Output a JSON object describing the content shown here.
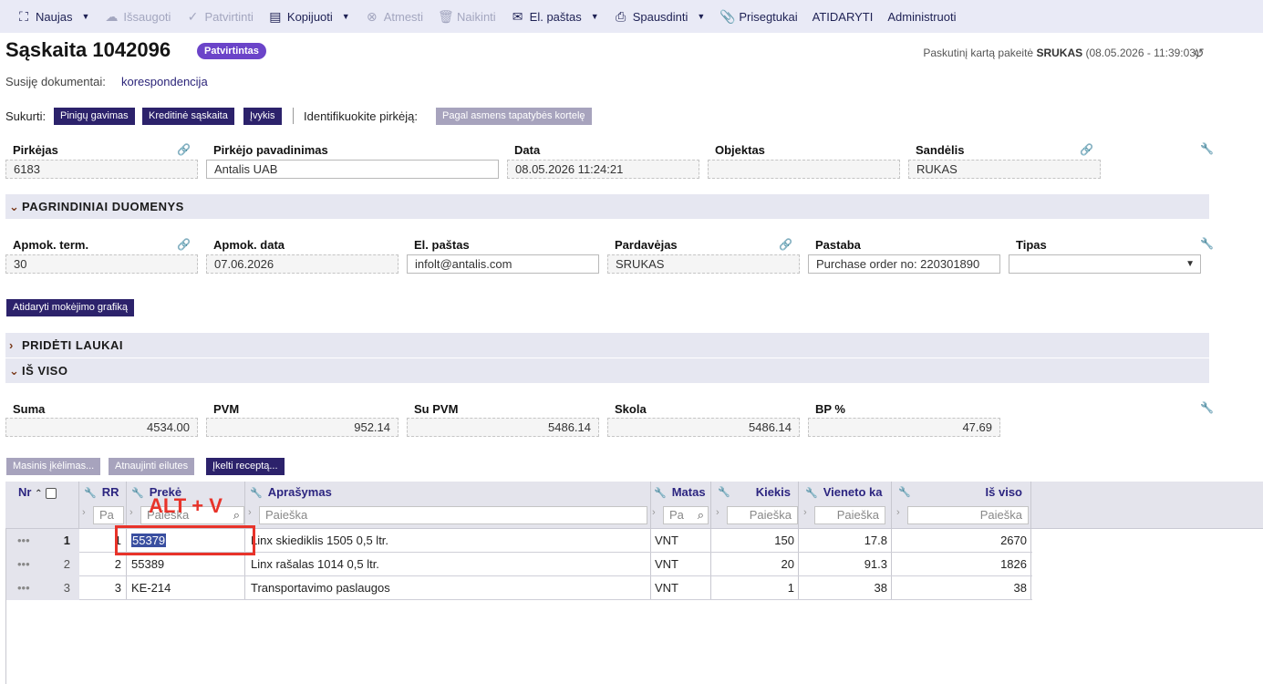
{
  "toolbar": {
    "new": "Naujas",
    "save": "Išsaugoti",
    "confirm": "Patvirtinti",
    "copy": "Kopijuoti",
    "reject": "Atmesti",
    "delete": "Naikinti",
    "email": "El. paštas",
    "print": "Spausdinti",
    "attachments": "Prisegtukai",
    "open": "ATIDARYTI",
    "administer": "Administruoti"
  },
  "header": {
    "title": "Sąskaita 1042096",
    "status_badge": "Patvirtintas",
    "last_modified_prefix": "Paskutinį kartą pakeitė",
    "last_modified_user": "SRUKAS",
    "last_modified_time": "(08.05.2026 - 11:39:03)"
  },
  "related": {
    "label": "Susiję dokumentai:",
    "link": "korespondencija"
  },
  "create": {
    "label": "Sukurti:",
    "buttons": [
      "Pinigų gavimas",
      "Kreditinė sąskaita",
      "Įvykis"
    ],
    "identify_label": "Identifikuokite pirkėją:",
    "identify_button": "Pagal asmens tapatybės kortelę"
  },
  "main_fields": {
    "buyer_label": "Pirkėjas",
    "buyer_value": "6183",
    "buyer_name_label": "Pirkėjo pavadinimas",
    "buyer_name_value": "Antalis UAB",
    "date_label": "Data",
    "date_value": "08.05.2026 11:24:21",
    "object_label": "Objektas",
    "object_value": "",
    "warehouse_label": "Sandėlis",
    "warehouse_value": "RUKAS"
  },
  "sections": {
    "main_data": "PAGRINDINIAI DUOMENYS",
    "added_fields": "PRIDĖTI LAUKAI",
    "total": "IŠ VISO"
  },
  "main_data": {
    "pay_term_label": "Apmok. term.",
    "pay_term_value": "30",
    "pay_date_label": "Apmok. data",
    "pay_date_value": "07.06.2026",
    "email_label": "El. paštas",
    "email_value": "infolt@antalis.com",
    "seller_label": "Pardavėjas",
    "seller_value": "SRUKAS",
    "note_label": "Pastaba",
    "note_value": "Purchase order no: 220301890",
    "type_label": "Tipas",
    "type_value": "",
    "schedule_button": "Atidaryti mokėjimo grafiką"
  },
  "totals": {
    "sum_label": "Suma",
    "sum_value": "4534.00",
    "vat_label": "PVM",
    "vat_value": "952.14",
    "with_vat_label": "Su PVM",
    "with_vat_value": "5486.14",
    "debt_label": "Skola",
    "debt_value": "5486.14",
    "bp_label": "BP %",
    "bp_value": "47.69"
  },
  "grid_buttons": [
    "Masinis įkėlimas...",
    "Atnaujinti eilutes",
    "Įkelti receptą..."
  ],
  "grid": {
    "columns": {
      "nr": "Nr",
      "rr": "RR",
      "item": "Prekė",
      "description": "Aprašymas",
      "unit": "Matas",
      "quantity": "Kiekis",
      "unit_price": "Vieneto ka",
      "total": "Iš viso"
    },
    "search": {
      "rr": "Pa",
      "item": "Paieška",
      "description": "Paieška",
      "unit": "Pa",
      "quantity": "Paieška",
      "unit_price": "Paieška",
      "total": "Paieška"
    },
    "rows": [
      {
        "nr": "1",
        "rr": "1",
        "item": "55379",
        "description": "Linx skiediklis 1505 0,5 ltr.",
        "unit": "VNT",
        "quantity": "150",
        "unit_price": "17.8",
        "total": "2670"
      },
      {
        "nr": "2",
        "rr": "2",
        "item": "55389",
        "description": "Linx rašalas 1014 0,5 ltr.",
        "unit": "VNT",
        "quantity": "20",
        "unit_price": "91.3",
        "total": "1826"
      },
      {
        "nr": "3",
        "rr": "3",
        "item": "KE-214",
        "description": "Transportavimo paslaugos",
        "unit": "VNT",
        "quantity": "1",
        "unit_price": "38",
        "total": "38"
      }
    ]
  },
  "annotation": {
    "shortcut": "ALT + V",
    "color": "#e8332a"
  }
}
